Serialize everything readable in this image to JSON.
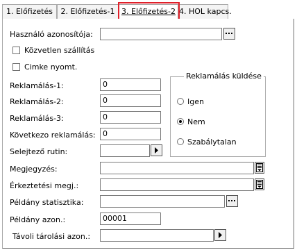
{
  "tabs": [
    {
      "label": "1. Előfizetés"
    },
    {
      "label": "2. Előfizetés-1"
    },
    {
      "label": "3. Előfizetés-2"
    },
    {
      "label": "4. HOL kapcs."
    }
  ],
  "form": {
    "hasznalo_azonositoja": {
      "label": "Használó azonosítója:",
      "value": ""
    },
    "kozvetlen_szallitas": {
      "label": "Közvetlen szállítás",
      "checked": false
    },
    "cimke_nyomt": {
      "label": "Cimke nyomt.",
      "checked": false
    },
    "reklamacio_1": {
      "label": "Reklamálás-1:",
      "value": "0"
    },
    "reklamacio_2": {
      "label": "Reklamálás-2:",
      "value": "0"
    },
    "reklamacio_3": {
      "label": "Reklamálás-3:",
      "value": "0"
    },
    "kovetkezo_reklamacio": {
      "label": "Következo reklamálás:",
      "value": "0"
    },
    "selejtezo_rutin": {
      "label": "Selejtező rutin:",
      "value": ""
    },
    "megjegyzes": {
      "label": "Megjegyzés:",
      "value": ""
    },
    "erkeztetesi_megj": {
      "label": "Érkeztetési megj.:",
      "value": ""
    },
    "peldany_statisztika": {
      "label": "Példány statisztika:",
      "value": ""
    },
    "peldany_azon": {
      "label": "Példány azon.:",
      "value": "00001"
    },
    "tavoli_tarolasi_azon": {
      "label": "Távoli tárolási azon.:",
      "value": ""
    }
  },
  "reklamacio_kuldese": {
    "title": "Reklamálás küldése",
    "options": [
      {
        "label": "Igen",
        "selected": false
      },
      {
        "label": "Nem",
        "selected": true
      },
      {
        "label": "Szabálytalan",
        "selected": false
      }
    ]
  },
  "icons": {
    "ellipsis": "ellipsis-icon",
    "arrow": "arrow-right-icon",
    "notes": "notes-icon"
  }
}
